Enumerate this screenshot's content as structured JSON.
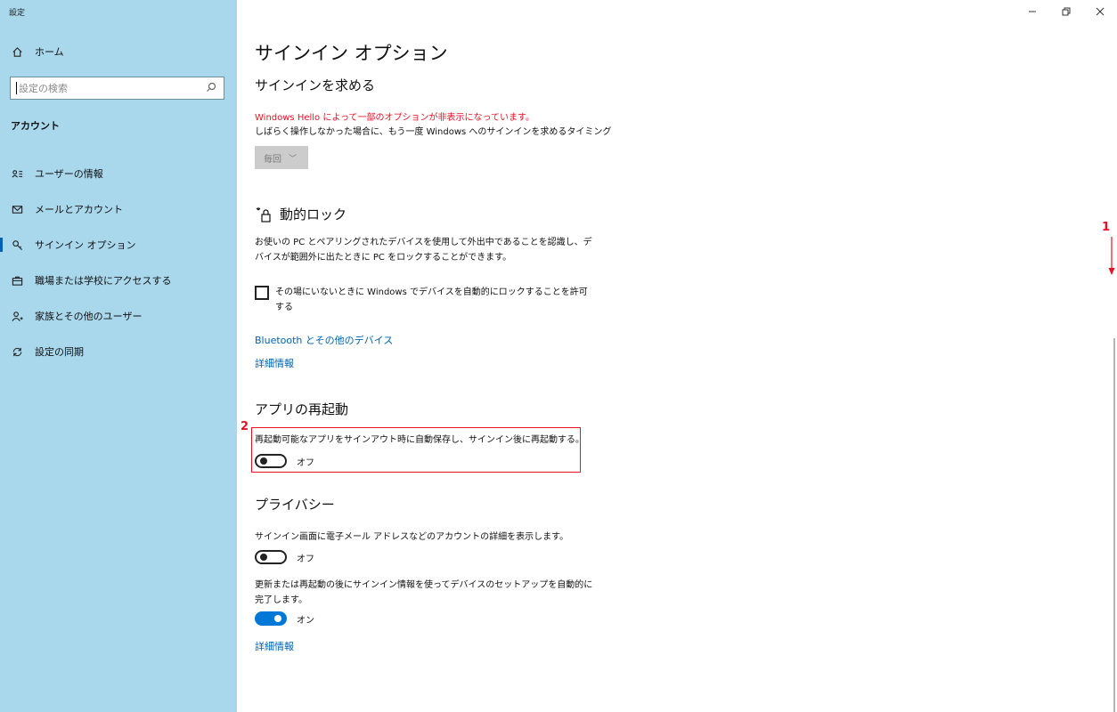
{
  "window": {
    "title": "設定",
    "controls": {
      "minimize": "—",
      "restore": "❐",
      "close": "✕"
    }
  },
  "sidebar": {
    "home_label": "ホーム",
    "search_placeholder": "設定の検索",
    "section_label": "アカウント",
    "items": [
      {
        "label": "ユーザーの情報",
        "icon": "person-card-icon",
        "active": false
      },
      {
        "label": "メールとアカウント",
        "icon": "mail-icon",
        "active": false
      },
      {
        "label": "サインイン オプション",
        "icon": "key-icon",
        "active": true
      },
      {
        "label": "職場または学校にアクセスする",
        "icon": "briefcase-icon",
        "active": false
      },
      {
        "label": "家族とその他のユーザー",
        "icon": "person-add-icon",
        "active": false
      },
      {
        "label": "設定の同期",
        "icon": "sync-icon",
        "active": false
      }
    ]
  },
  "main": {
    "page_title": "サインイン オプション",
    "require_signin": {
      "heading": "サインインを求める",
      "warning": "Windows Hello によって一部のオプションが非表示になっています。",
      "description": "しばらく操作しなかった場合に、もう一度 Windows へのサインインを求めるタイミング",
      "dropdown_value": "毎回"
    },
    "dynamic_lock": {
      "heading": "動的ロック",
      "description": "お使いの PC とペアリングされたデバイスを使用して外出中であることを認識し、デバイスが範囲外に出たときに PC をロックすることができます。",
      "checkbox_label": "その場にいないときに Windows でデバイスを自動的にロックすることを許可する",
      "checkbox_checked": false,
      "link_bluetooth": "Bluetooth とその他のデバイス",
      "link_details": "詳細情報"
    },
    "app_restart": {
      "heading": "アプリの再起動",
      "description": "再起動可能なアプリをサインアウト時に自動保存し、サインイン後に再起動する。",
      "toggle_state": "オフ",
      "toggle_on": false
    },
    "privacy": {
      "heading": "プライバシー",
      "description1": "サインイン画面に電子メール アドレスなどのアカウントの詳細を表示します。",
      "toggle1_state": "オフ",
      "toggle1_on": false,
      "description2": "更新または再起動の後にサインイン情報を使ってデバイスのセットアップを自動的に完了します。",
      "toggle2_state": "オン",
      "toggle2_on": true,
      "link_details": "詳細情報"
    }
  },
  "annotations": {
    "step1": "1",
    "step2": "2"
  },
  "colors": {
    "sidebar_bg": "#a9d7ec",
    "accent": "#0078d7",
    "warning": "#e81123",
    "link": "#0063b1"
  }
}
